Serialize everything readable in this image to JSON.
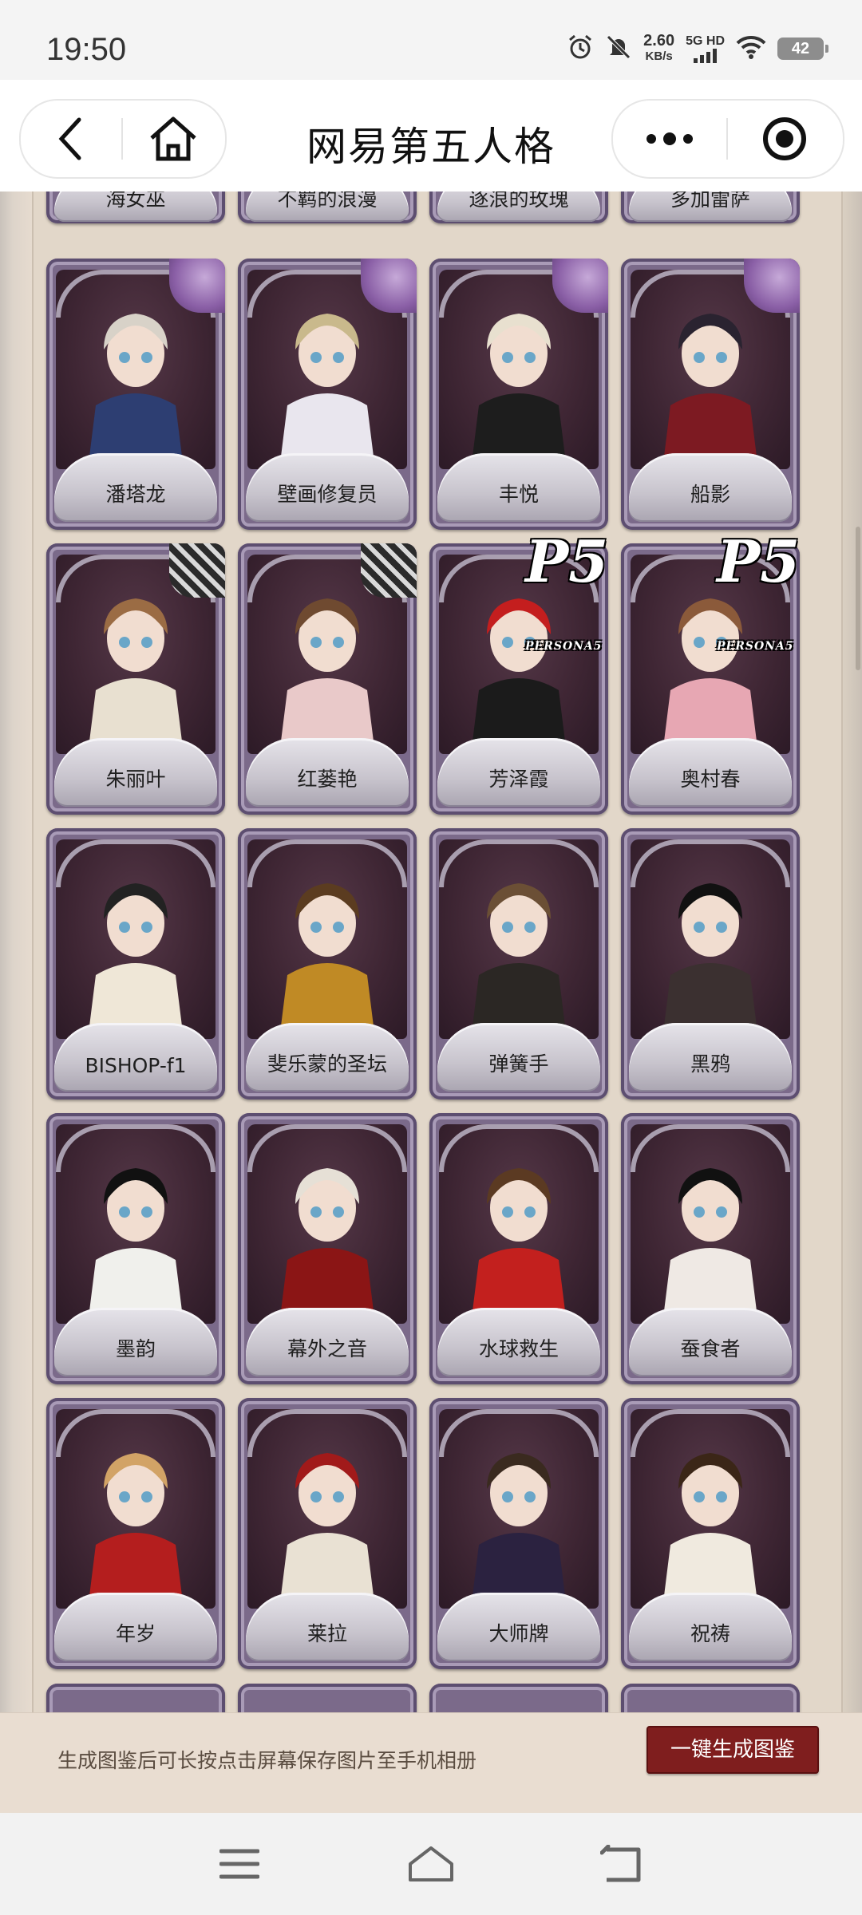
{
  "status_bar": {
    "time": "19:50",
    "net_speed_value": "2.60",
    "net_speed_unit": "KB/s",
    "network_type": "5G HD",
    "battery": "42",
    "icons": [
      "alarm-icon",
      "mute-icon",
      "signal-icon",
      "wifi-icon",
      "battery-icon"
    ]
  },
  "nav": {
    "title": "网易第五人格",
    "left_buttons": [
      "back-icon",
      "home-icon"
    ],
    "right_buttons": [
      "more-icon",
      "close-miniprogram-icon"
    ]
  },
  "top_row_partial": [
    "海女巫",
    "不羁的浪漫",
    "逐浪的玫瑰",
    "多加雷萨"
  ],
  "cards": [
    {
      "name": "潘塔龙",
      "badge": "purple"
    },
    {
      "name": "壁画修复员",
      "badge": "purple"
    },
    {
      "name": "丰悦",
      "badge": "purple"
    },
    {
      "name": "船影",
      "badge": "purple"
    },
    {
      "name": "朱丽叶",
      "badge": "stripes"
    },
    {
      "name": "红蒌艳",
      "badge": "stripes"
    },
    {
      "name": "芳泽霞",
      "badge": "p5"
    },
    {
      "name": "奥村春",
      "badge": "p5"
    },
    {
      "name": "BISHOP-f1",
      "badge": "none"
    },
    {
      "name": "斐乐蒙的圣坛",
      "badge": "none"
    },
    {
      "name": "弹簧手",
      "badge": "none"
    },
    {
      "name": "黑鸦",
      "badge": "none"
    },
    {
      "name": "墨韵",
      "badge": "none"
    },
    {
      "name": "幕外之音",
      "badge": "none"
    },
    {
      "name": "水球救生",
      "badge": "none"
    },
    {
      "name": "蚕食者",
      "badge": "none"
    },
    {
      "name": "年岁",
      "badge": "none"
    },
    {
      "name": "莱拉",
      "badge": "none"
    },
    {
      "name": "大师牌",
      "badge": "none"
    },
    {
      "name": "祝祷",
      "badge": "none"
    }
  ],
  "p5_logo": {
    "mark": "P5",
    "text": "PERSONA5"
  },
  "banner": {
    "hint": "生成图鉴后可长按点击屏幕保存图片至手机相册",
    "button": "一键生成图鉴"
  },
  "colors": {
    "card_frame": "#7b6a8a",
    "card_art_bg": "#3f2634",
    "button_red": "#7f1e1e",
    "page_bg": "#e2d7c9"
  }
}
